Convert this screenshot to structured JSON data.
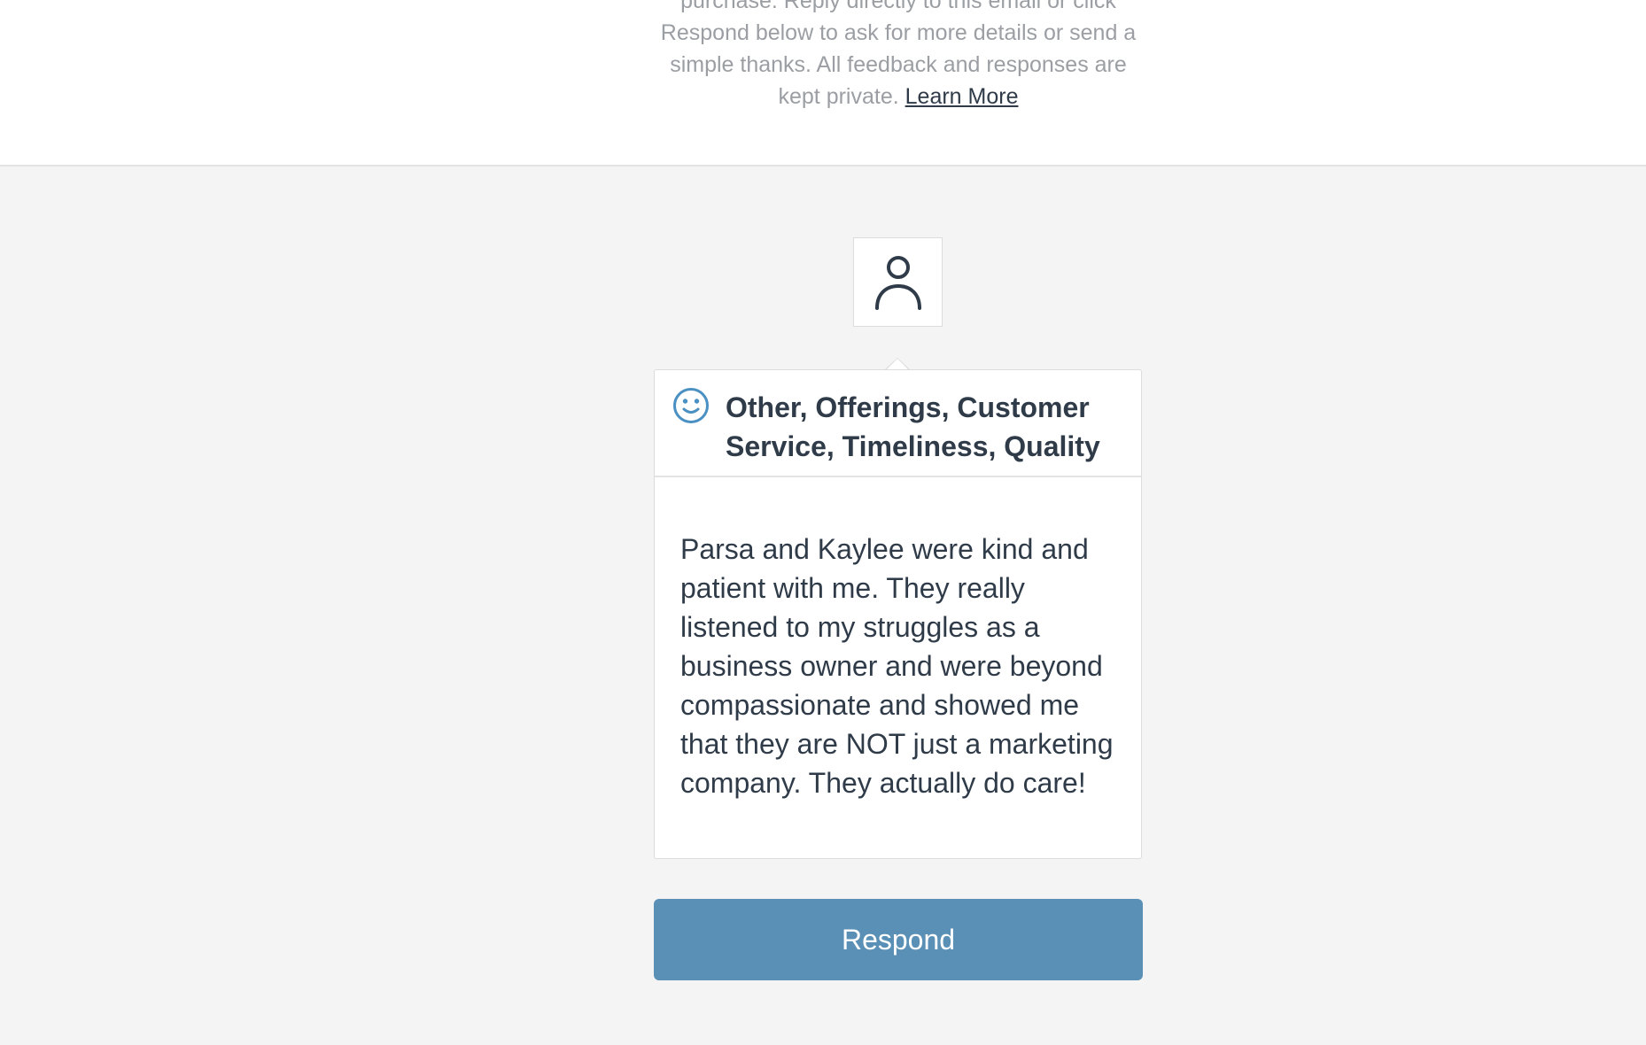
{
  "intro": {
    "text": "purchase. Reply directly to this email or click Respond below to ask for more details or send a simple thanks. All feedback and responses are kept private.",
    "learn_more_label": "Learn More"
  },
  "feedback": {
    "avatar_icon": "user-icon",
    "sentiment_icon": "smile-icon",
    "sentiment_color": "#4a90c2",
    "categories": "Other, Offerings, Customer Service, Timeliness, Quality",
    "review": "Parsa and Kaylee were kind and patient with me. They really listened to my struggles as a business owner and were beyond compassionate and showed me that they are NOT just a marketing company. They actually do care!"
  },
  "actions": {
    "respond_label": "Respond",
    "respond_color": "#5a90b6"
  }
}
